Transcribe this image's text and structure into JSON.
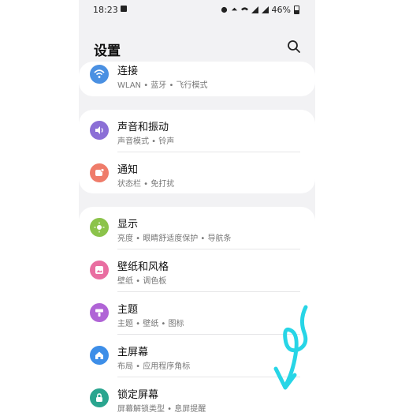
{
  "status": {
    "time": "18:23",
    "battery": "46%"
  },
  "header": {
    "title": "设置"
  },
  "cards": [
    {
      "items": [
        {
          "title": "连接",
          "subtitle": "WLAN • 蓝牙 • 飞行模式",
          "icon": "wifi-icon",
          "color": "#4a90e2"
        }
      ]
    },
    {
      "items": [
        {
          "title": "声音和振动",
          "subtitle": "声音模式 • 铃声",
          "icon": "volume-icon",
          "color": "#8b6fd6"
        },
        {
          "title": "通知",
          "subtitle": "状态栏 • 免打扰",
          "icon": "notification-icon",
          "color": "#ef7c6a"
        }
      ]
    },
    {
      "items": [
        {
          "title": "显示",
          "subtitle": "亮度 • 眼睛舒适度保护 • 导航条",
          "icon": "sun-icon",
          "color": "#8bc34a"
        },
        {
          "title": "壁纸和风格",
          "subtitle": "壁纸 • 调色板",
          "icon": "wallpaper-icon",
          "color": "#e96ea1"
        },
        {
          "title": "主题",
          "subtitle": "主题 • 壁纸 • 图标",
          "icon": "theme-icon",
          "color": "#b064d6"
        },
        {
          "title": "主屏幕",
          "subtitle": "布局 • 应用程序角标",
          "icon": "home-icon",
          "color": "#3d8ee8"
        },
        {
          "title": "锁定屏幕",
          "subtitle": "屏幕解锁类型 • 息屏提醒",
          "icon": "lock-icon",
          "color": "#2aa58f"
        }
      ]
    }
  ],
  "colors": {
    "arrow": "#27d5e6"
  }
}
